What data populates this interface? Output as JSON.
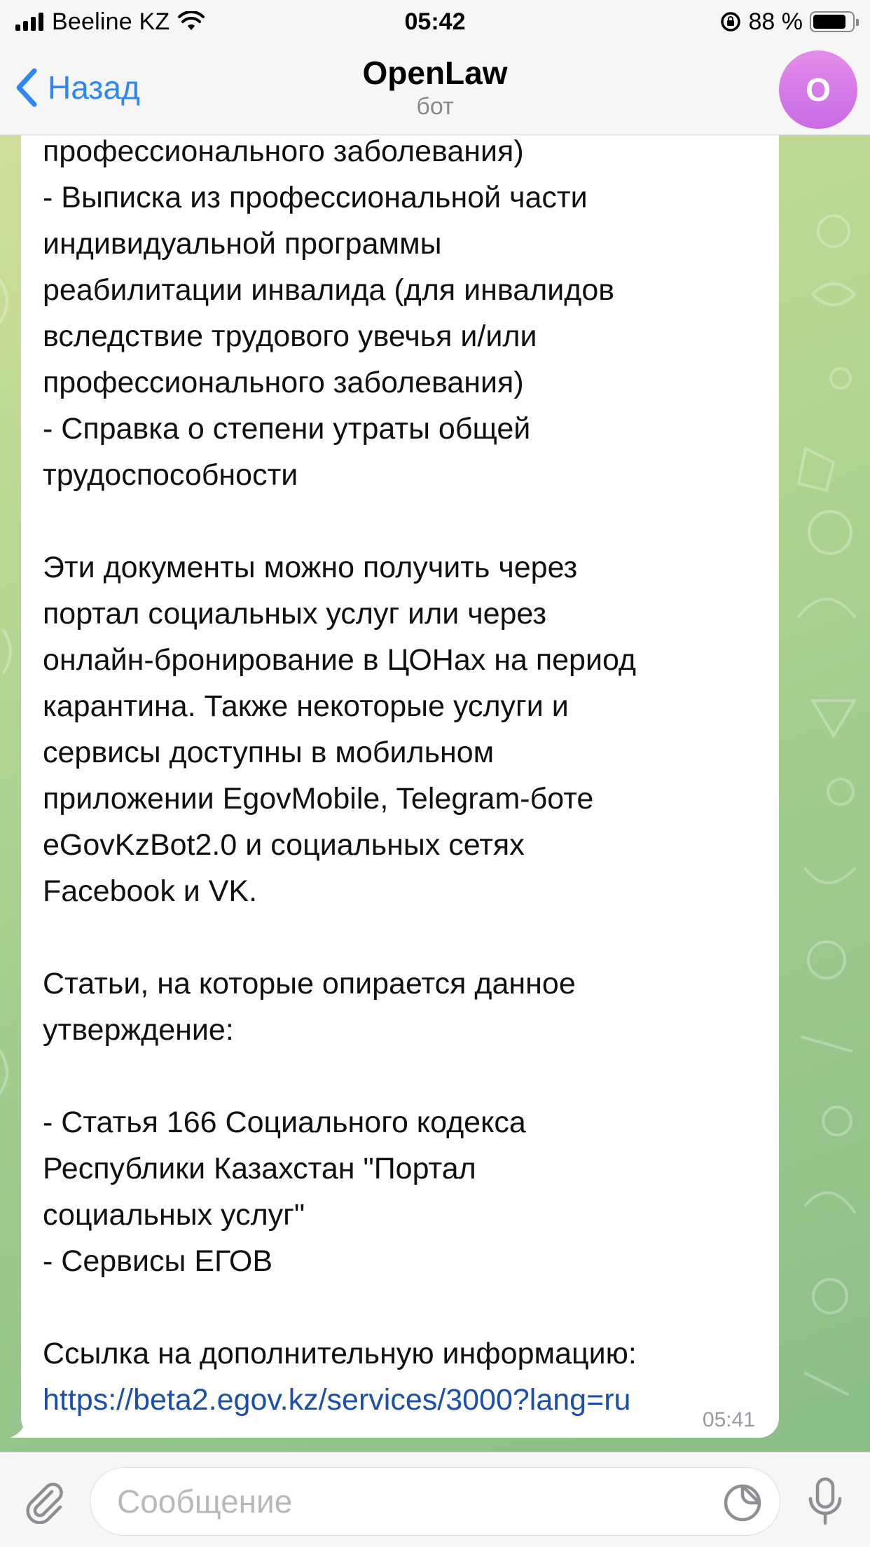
{
  "status_bar": {
    "carrier": "Beeline KZ",
    "time": "05:42",
    "battery_percent": "88 %",
    "battery_level": 0.88
  },
  "header": {
    "back_label": "Назад",
    "title": "OpenLaw",
    "subtitle": "бот",
    "avatar_letter": "O"
  },
  "message": {
    "lines": [
      "профессионального заболевания)",
      "- Выписка из профессиональной части",
      "индивидуальной программы",
      "реабилитации инвалида (для инвалидов",
      "вследствие трудового увечья и/или",
      "профессионального заболевания)",
      "- Справка о степени утраты общей",
      "трудоспособности",
      "",
      "Эти документы можно получить через",
      "портал социальных услуг или через",
      "онлайн-бронирование в ЦОНах на период",
      "карантина. Также некоторые услуги и",
      "сервисы доступны в мобильном",
      "приложении EgovMobile, Telegram-боте",
      "eGovKzBot2.0 и социальных сетях",
      "Facebook и VK.",
      "",
      "Статьи, на которые опирается данное",
      "утверждение:",
      "",
      "- Статья 166 Социального кодекса",
      "Республики Казахстан \"Портал",
      "социальных услуг\"",
      "- Сервисы ЕГОВ",
      "",
      "Ссылка на дополнительную информацию:"
    ],
    "link": "https://beta2.egov.kz/services/3000?lang=ru",
    "time": "05:41"
  },
  "input_bar": {
    "placeholder": "Сообщение",
    "value": ""
  },
  "colors": {
    "accent": "#2f86f5",
    "link": "#1b4fae",
    "avatar": "#d47be8"
  },
  "icons": {
    "back": "chevron-left-icon",
    "attach": "paperclip-icon",
    "sticker": "sticker-icon",
    "mic": "microphone-icon",
    "signal": "signal-icon",
    "wifi": "wifi-icon",
    "rotation_lock": "rotation-lock-icon",
    "battery": "battery-icon"
  }
}
